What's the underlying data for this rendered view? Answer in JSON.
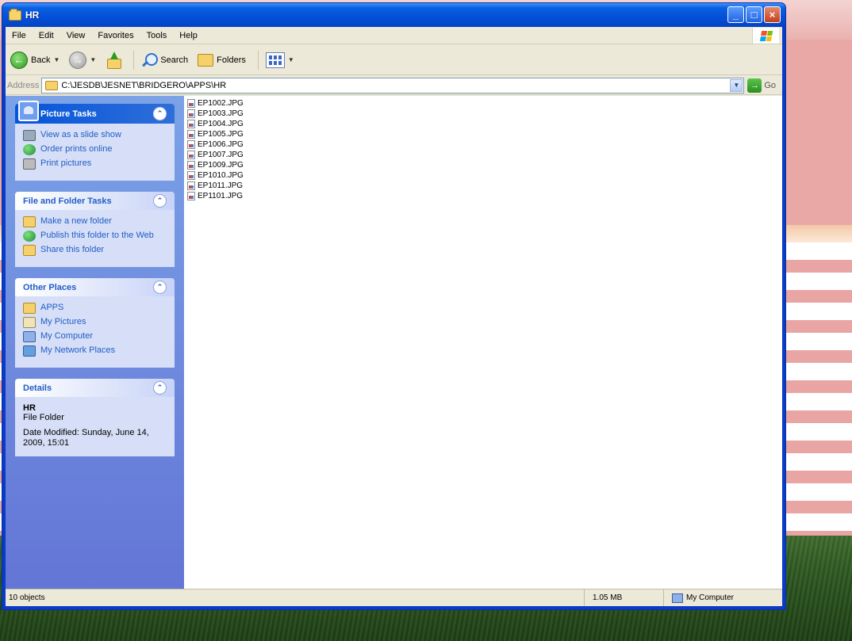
{
  "window": {
    "title": "HR",
    "buttons": {
      "minimize": "_",
      "maximize": "□",
      "close": "×"
    }
  },
  "menubar": {
    "items": [
      "File",
      "Edit",
      "View",
      "Favorites",
      "Tools",
      "Help"
    ]
  },
  "toolbar": {
    "back_label": "Back",
    "search_label": "Search",
    "folders_label": "Folders"
  },
  "address": {
    "label": "Address",
    "path": "C:\\JESDB\\JESNET\\BRIDGERO\\APPS\\HR",
    "go_label": "Go"
  },
  "taskpane": {
    "picture_tasks": {
      "title": "Picture Tasks",
      "items": [
        "View as a slide show",
        "Order prints online",
        "Print pictures"
      ]
    },
    "file_folder_tasks": {
      "title": "File and Folder Tasks",
      "items": [
        "Make a new folder",
        "Publish this folder to the Web",
        "Share this folder"
      ]
    },
    "other_places": {
      "title": "Other Places",
      "items": [
        "APPS",
        "My Pictures",
        "My Computer",
        "My Network Places"
      ]
    },
    "details": {
      "title": "Details",
      "name": "HR",
      "type": "File Folder",
      "modified": "Date Modified: Sunday, June 14, 2009, 15:01"
    }
  },
  "files": [
    "EP1002.JPG",
    "EP1003.JPG",
    "EP1004.JPG",
    "EP1005.JPG",
    "EP1006.JPG",
    "EP1007.JPG",
    "EP1009.JPG",
    "EP1010.JPG",
    "EP1011.JPG",
    "EP1101.JPG"
  ],
  "statusbar": {
    "objects": "10 objects",
    "size": "1.05 MB",
    "zone": "My Computer"
  }
}
